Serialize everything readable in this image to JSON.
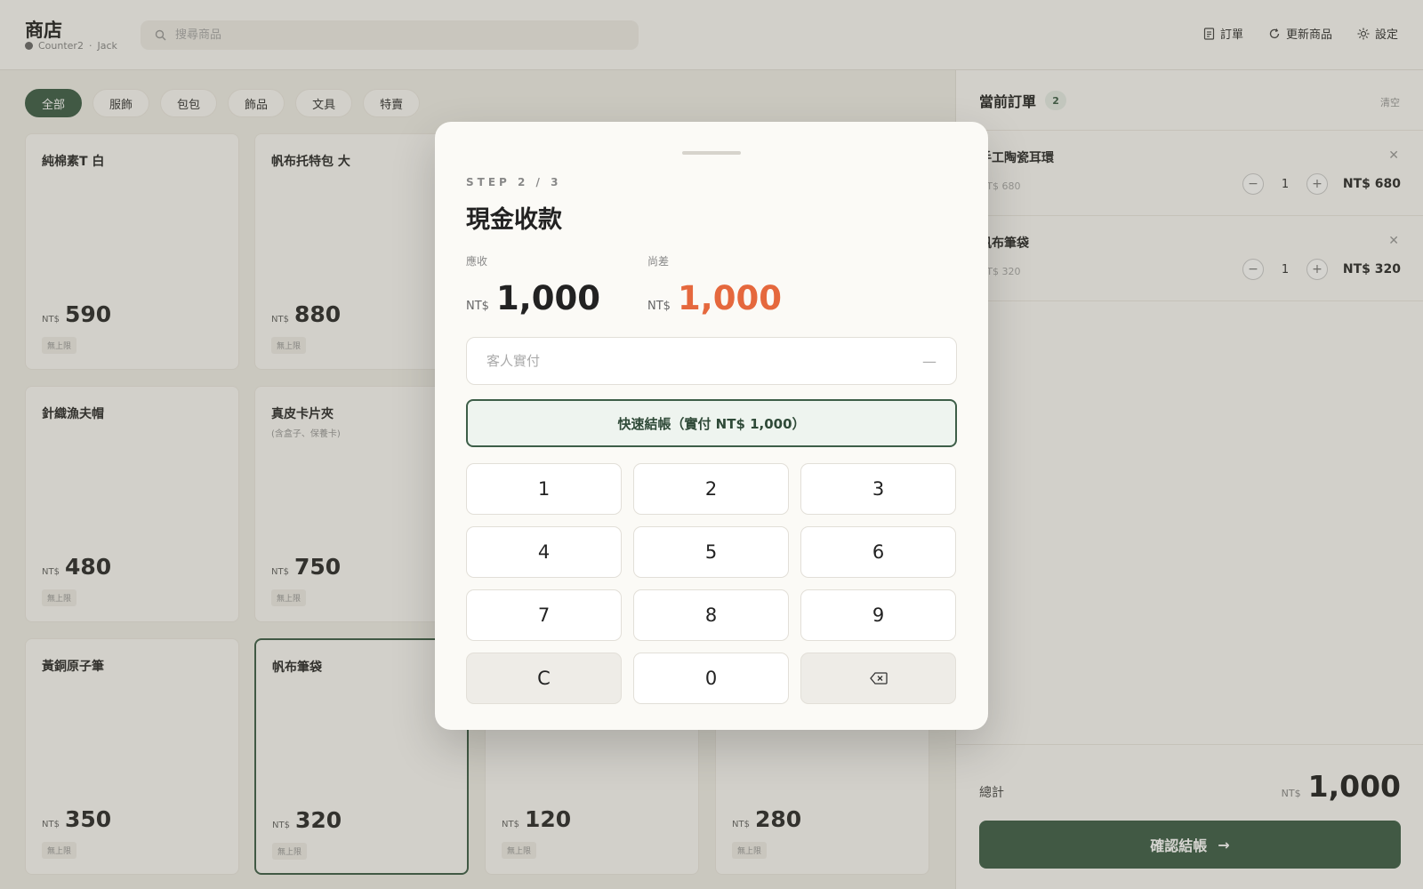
{
  "header": {
    "store_title": "商店",
    "counter": "Counter2",
    "separator": "·",
    "user": "Jack",
    "search_placeholder": "搜尋商品",
    "actions": [
      {
        "label": "訂單",
        "icon": "receipt-icon"
      },
      {
        "label": "更新商品",
        "icon": "refresh-icon"
      },
      {
        "label": "設定",
        "icon": "gear-icon"
      }
    ]
  },
  "categories": [
    {
      "label": "全部",
      "active": true
    },
    {
      "label": "服飾",
      "active": false
    },
    {
      "label": "包包",
      "active": false
    },
    {
      "label": "飾品",
      "active": false
    },
    {
      "label": "文具",
      "active": false
    },
    {
      "label": "特賣",
      "active": false
    }
  ],
  "products": [
    {
      "name": "純棉素T 白",
      "sub": "",
      "currency": "NT$",
      "price": "590",
      "badge": "無上限"
    },
    {
      "name": "帆布托特包 大",
      "sub": "",
      "currency": "NT$",
      "price": "880",
      "badge": "無上限"
    },
    {
      "name": "針織漁夫帽",
      "sub": "",
      "currency": "NT$",
      "price": "480",
      "badge": "無上限"
    },
    {
      "name": "真皮卡片夾",
      "sub": "(含盒子、保養卡)",
      "currency": "NT$",
      "price": "750",
      "badge": "無上限"
    },
    {
      "name": "黃銅原子筆",
      "sub": "",
      "currency": "NT$",
      "price": "350",
      "badge": "無上限"
    },
    {
      "name": "帆布筆袋",
      "sub": "",
      "currency": "NT$",
      "price": "320",
      "badge": "無上限",
      "selected": true
    },
    {
      "name": "",
      "sub": "",
      "currency": "NT$",
      "price": "120",
      "badge": "無上限"
    },
    {
      "name": "",
      "sub": "",
      "currency": "NT$",
      "price": "280",
      "badge": "無上限"
    }
  ],
  "order": {
    "title": "當前訂單",
    "count": "2",
    "clear_label": "清空",
    "items": [
      {
        "name": "手工陶瓷耳環",
        "unit_price": "NT$ 680",
        "qty": "1",
        "total": "NT$ 680"
      },
      {
        "name": "帆布筆袋",
        "unit_price": "NT$ 320",
        "qty": "1",
        "total": "NT$ 320"
      }
    ],
    "total_label": "總計",
    "total_currency": "NT$",
    "total_value": "1,000",
    "confirm_label": "確認結帳",
    "confirm_arrow": "→"
  },
  "modal": {
    "step": "STEP 2 / 3",
    "title": "現金收款",
    "receivable_label": "應收",
    "receivable_currency": "NT$",
    "receivable_value": "1,000",
    "due_label": "尚差",
    "due_currency": "NT$",
    "due_value": "1,000",
    "due_color": "#e5683d",
    "paid_placeholder": "客人實付",
    "paid_dash": "—",
    "quick_checkout_label": "快速結帳（實付 NT$ 1,000）",
    "keys": [
      "1",
      "2",
      "3",
      "4",
      "5",
      "6",
      "7",
      "8",
      "9",
      "C",
      "0",
      "⌫"
    ]
  },
  "colors": {
    "accent": "#3d5e48",
    "due": "#e5683d"
  }
}
